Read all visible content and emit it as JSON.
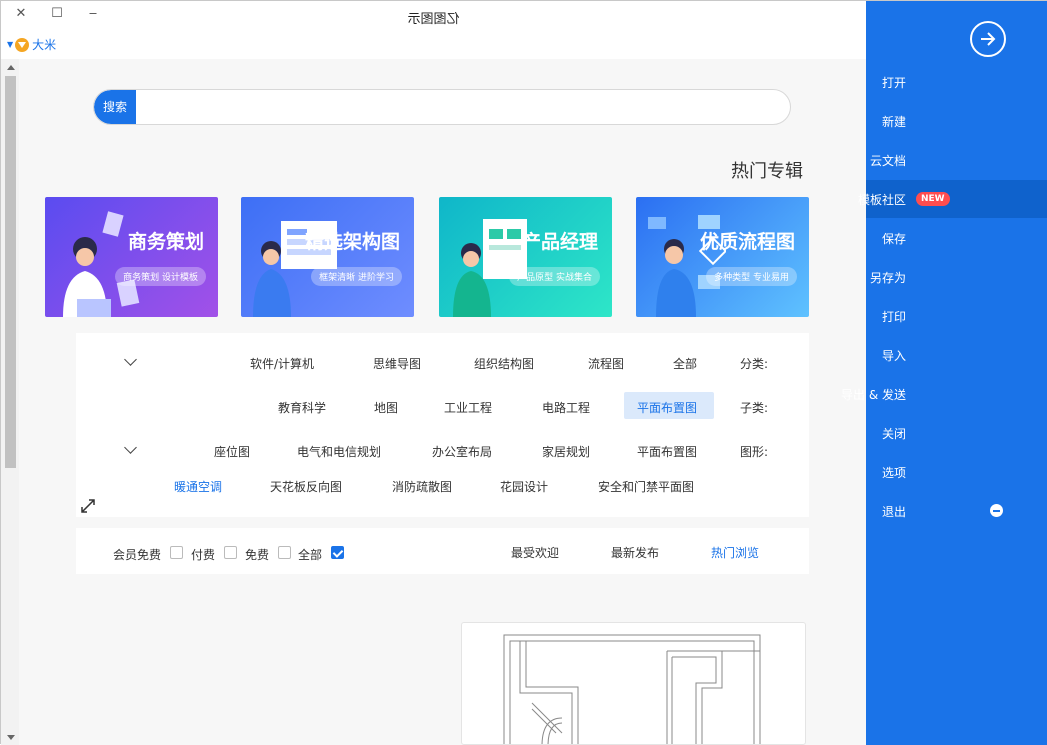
{
  "window": {
    "title": "亿图图示",
    "close": "✕",
    "maximize": "☐",
    "minimize": "‒"
  },
  "user": {
    "name": "大米"
  },
  "sidebar": {
    "items": [
      {
        "label": "打开"
      },
      {
        "label": "新建"
      },
      {
        "label": "云文档"
      },
      {
        "label": "模板社区",
        "badge": "NEW",
        "active": true
      },
      {
        "label": "保存"
      },
      {
        "label": "另存为"
      },
      {
        "label": "打印"
      },
      {
        "label": "导入"
      },
      {
        "label": "导出 & 发送"
      },
      {
        "label": "关闭"
      },
      {
        "label": "选项"
      },
      {
        "label": "退出"
      }
    ]
  },
  "search": {
    "button": "搜索",
    "placeholder": ""
  },
  "hot": {
    "title": "热门专辑"
  },
  "banners": [
    {
      "title": "优质流程图",
      "subtitle": "多种类型 专业易用"
    },
    {
      "title": "产品经理",
      "subtitle": "产品原型 实战集合"
    },
    {
      "title": "精选架构图",
      "subtitle": "框架清晰 进阶学习"
    },
    {
      "title": "商务策划",
      "subtitle": "商务策划 设计模板"
    }
  ],
  "filters": {
    "category": {
      "label": "分类:",
      "items": [
        "全部",
        "流程图",
        "组织结构图",
        "思维导图",
        "软件/计算机"
      ]
    },
    "subcategory": {
      "label": "子类:",
      "items": [
        "平面布置图",
        "电路工程",
        "工业工程",
        "地图",
        "教育科学"
      ],
      "selected": "平面布置图"
    },
    "shape": {
      "label": "图形:",
      "row1": [
        "平面布置图",
        "家居规划",
        "办公室布局",
        "电气和电信规划",
        "座位图"
      ],
      "row2": [
        "安全和门禁平面图",
        "花园设计",
        "消防疏散图",
        "天花板反向图",
        "暖通空调"
      ],
      "active": "暖通空调"
    }
  },
  "sort": {
    "tabs": [
      "热门浏览",
      "最新发布",
      "最受欢迎"
    ],
    "active": "热门浏览"
  },
  "price": {
    "items": [
      "全部",
      "免费",
      "付费",
      "会员免费"
    ],
    "checked": "全部"
  },
  "colors": {
    "accent": "#1a73e8",
    "badge": "#ff4d4f"
  }
}
